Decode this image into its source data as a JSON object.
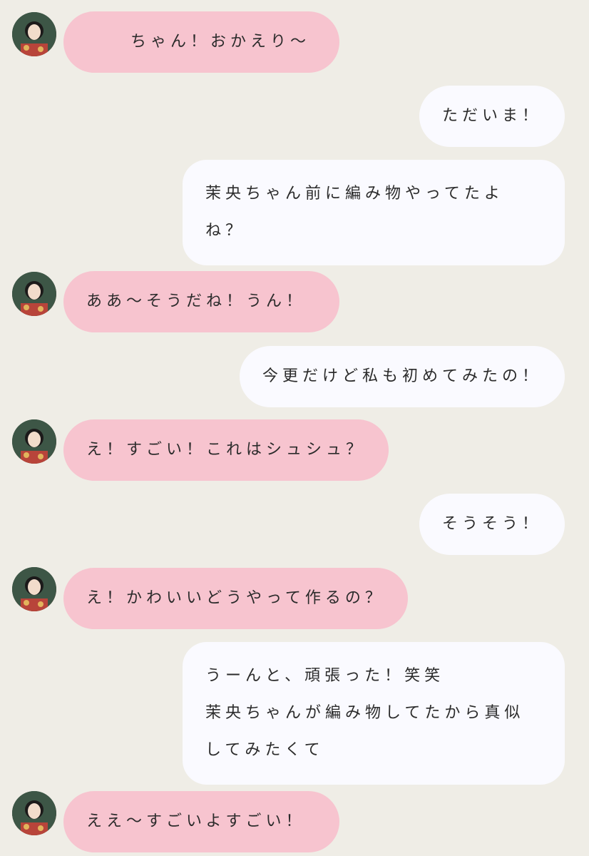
{
  "messages": [
    {
      "side": "left",
      "text": "ちゃん！おかえり〜"
    },
    {
      "side": "right",
      "text": "ただいま！"
    },
    {
      "side": "right",
      "lines": [
        "茉央ちゃん前に編み物やってたよ",
        "ね？"
      ]
    },
    {
      "side": "left",
      "text": "ああ〜そうだね！うん！"
    },
    {
      "side": "right",
      "text": "今更だけど私も初めてみたの！"
    },
    {
      "side": "left",
      "text": "え！すごい！これはシュシュ？"
    },
    {
      "side": "right",
      "text": "そうそう！"
    },
    {
      "side": "left",
      "text": "え！かわいいどうやって作るの？"
    },
    {
      "side": "right",
      "lines": [
        "うーんと、頑張った！笑笑",
        "茉央ちゃんが編み物してたから真似",
        "してみたくて"
      ]
    },
    {
      "side": "left",
      "text": "ええ〜すごいよすごい！"
    }
  ],
  "colors": {
    "background": "#efede6",
    "left_bubble": "#f7c4cf",
    "right_bubble": "#fafaff"
  },
  "icons": {
    "avatar": "contact-avatar-photo"
  }
}
